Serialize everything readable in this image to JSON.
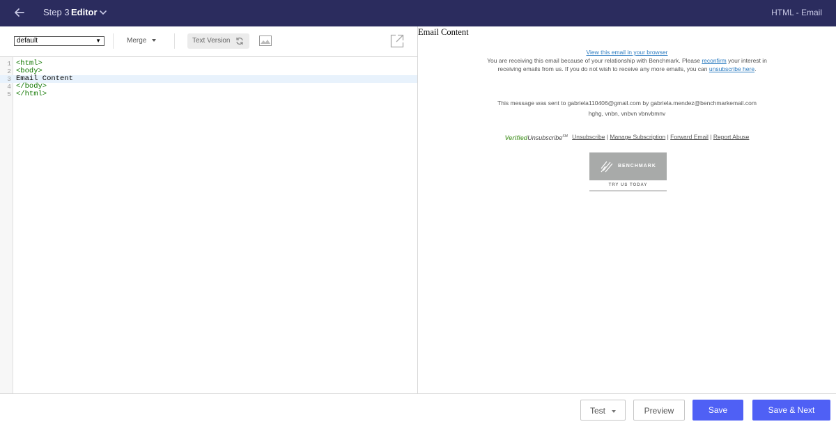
{
  "header": {
    "back_icon": "arrow-left-icon",
    "step_label": "Step 3",
    "step_name": "Editor",
    "mode_label": "HTML - Email"
  },
  "toolbar": {
    "template_select": "default",
    "merge_label": "Merge",
    "text_version_label": "Text Version",
    "image_icon": "image-icon",
    "popout_icon": "external-window-icon"
  },
  "code": {
    "lines": [
      {
        "num": "1",
        "text": "<html>"
      },
      {
        "num": "2",
        "text": "<body>"
      },
      {
        "num": "3",
        "text": "Email Content"
      },
      {
        "num": "4",
        "text": "</body>"
      },
      {
        "num": "5",
        "text": "</html>"
      }
    ]
  },
  "preview": {
    "email_content": "Email Content",
    "view_in_browser": "View this email in your browser",
    "notice_part1": "You are receiving this email because of your relationship with Benchmark. Please",
    "reconfirm": "reconfirm",
    "notice_part2": "your interest in",
    "notice_part3": "receiving emails from us. If you do not wish to receive any more emails, you can",
    "unsubscribe_here": "unsubscribe here",
    "sent_to": "This message was sent to gabriela110406@gmail.com by gabriela.mendez@benchmarkemail.com",
    "address": "hghg, vnbn, vnbvn vbnvbmnv",
    "verified_unsubscribe_a": "Verified",
    "verified_unsubscribe_b": "Unsubscribe",
    "verified_unsubscribe_sm": "SM",
    "links": {
      "unsubscribe": "Unsubscribe",
      "manage": "Manage Subscription",
      "forward": "Forward Email",
      "report": "Report Abuse"
    },
    "benchmark_logo": "BENCHMARK",
    "try_us": "TRY US TODAY"
  },
  "footer": {
    "test_label": "Test",
    "preview_label": "Preview",
    "save_label": "Save",
    "save_next_label": "Save & Next"
  },
  "colors": {
    "header_bg": "#2b2c5e",
    "primary": "#4f60f5",
    "link": "#2b7bc0",
    "code_tag": "#117700"
  }
}
